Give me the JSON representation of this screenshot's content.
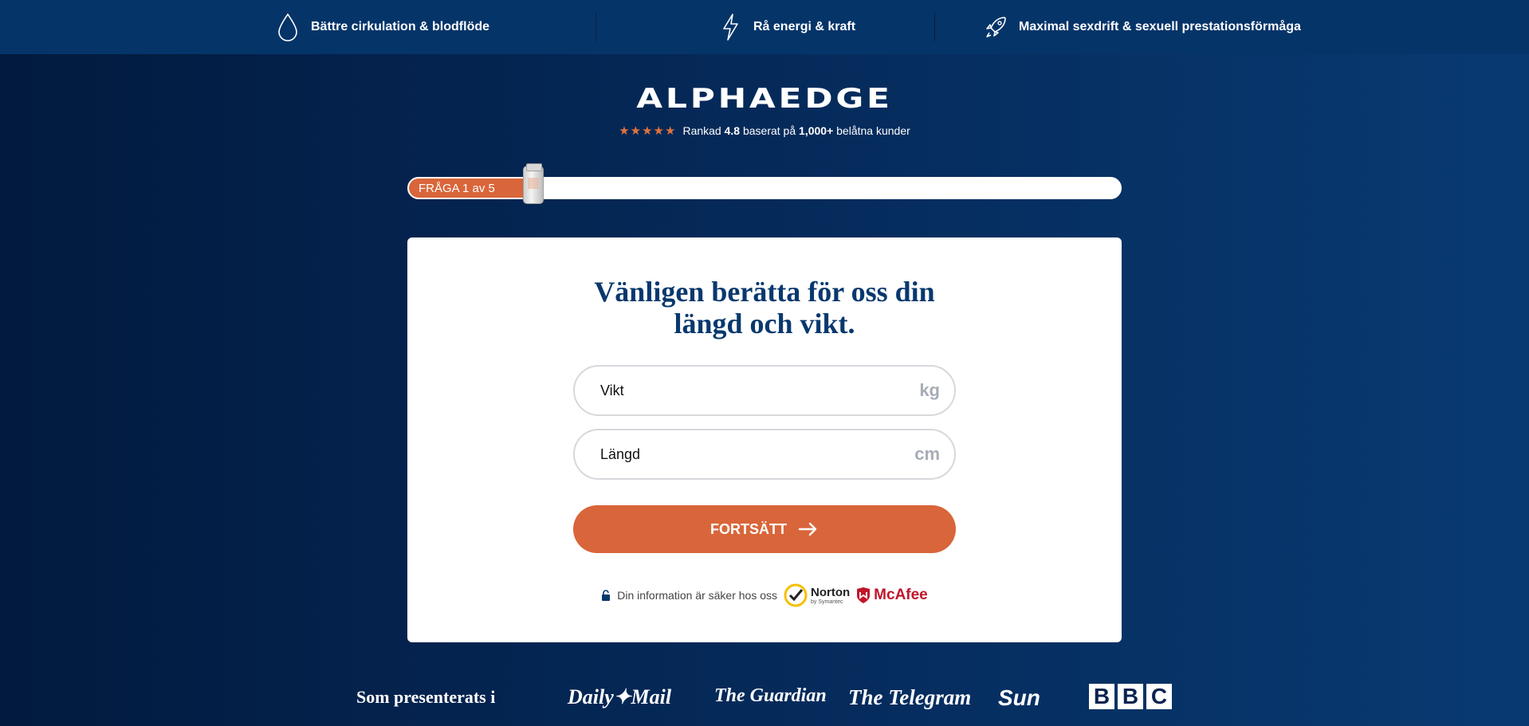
{
  "topbar": {
    "benefits": [
      {
        "label": "Bättre cirkulation & blodflöde",
        "icon": "drop-icon"
      },
      {
        "label": "Rå energi & kraft",
        "icon": "lightning-icon"
      },
      {
        "label": "Maximal sexdrift & sexuell prestationsförmåga",
        "icon": "rocket-icon"
      }
    ]
  },
  "brand": {
    "logo": "ALPHAEDGE",
    "stars": "★★★★★",
    "rating_prefix": "Rankad",
    "rating_value": "4.8",
    "rating_mid": "baserat på",
    "rating_count": "1,000+",
    "rating_suffix": "belåtna kunder"
  },
  "progress": {
    "label": "FRÅGA 1 av 5",
    "current": 1,
    "total": 5
  },
  "form": {
    "title_line1": "Vänligen berätta för oss din",
    "title_line2": "längd och vikt.",
    "weight_placeholder": "Vikt",
    "weight_unit": "kg",
    "height_placeholder": "Längd",
    "height_unit": "cm",
    "continue_label": "FORTSÄTT",
    "secure_text": "Din information är säker hos oss",
    "norton_label": "Norton",
    "norton_sub": "by Symantec",
    "mcafee_label": "McAfee"
  },
  "press": {
    "label": "Som presenterats i",
    "logos": [
      "Daily Mail",
      "The Guardian",
      "The Telegram",
      "Sun",
      "BBC"
    ],
    "logo_dailymail": "Daily✦Mail",
    "logo_guardian": "The Guardian",
    "logo_telegram": "The Telegram",
    "logo_sun": "Sun",
    "logo_bbc": [
      "B",
      "B",
      "C"
    ]
  },
  "colors": {
    "accent": "#d9653a",
    "navy": "#08386e",
    "topbar": "#053469"
  }
}
